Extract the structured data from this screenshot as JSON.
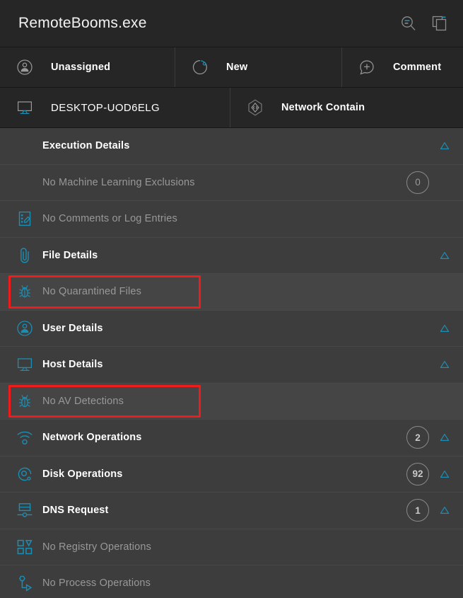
{
  "header": {
    "title": "RemoteBooms.exe",
    "actions": [
      {
        "name": "search-filter-icon",
        "label": "Search"
      },
      {
        "name": "copy-icon",
        "label": "Copy"
      }
    ]
  },
  "meta_rows": [
    [
      {
        "icon": "user-circle-icon",
        "label": "Unassigned",
        "bold": true
      },
      {
        "icon": "status-new-icon",
        "label": "New",
        "bold": true
      },
      {
        "icon": "comment-plus-icon",
        "label": "Comment",
        "bold": true
      }
    ],
    [
      {
        "icon": "monitor-icon",
        "label": "DESKTOP-UOD6ELG",
        "bold": false
      },
      {
        "icon": "network-contain-icon",
        "label": "Network Contain",
        "bold": true
      }
    ]
  ],
  "list": [
    {
      "icon": null,
      "label": "Execution Details",
      "state": "header",
      "count": null,
      "chevron": true,
      "highlight": false
    },
    {
      "icon": null,
      "label": "No Machine Learning Exclusions",
      "state": "muted",
      "count": "0",
      "chevron": false,
      "highlight": false
    },
    {
      "icon": "comments-log-icon",
      "label": "No Comments or Log Entries",
      "state": "muted",
      "count": null,
      "chevron": false,
      "highlight": false
    },
    {
      "icon": "paperclip-icon",
      "label": "File Details",
      "state": "active",
      "count": null,
      "chevron": true,
      "highlight": false
    },
    {
      "icon": "bug-icon",
      "label": "No Quarantined Files",
      "state": "muted",
      "count": null,
      "chevron": false,
      "highlight": true
    },
    {
      "icon": "user-circle-icon",
      "label": "User Details",
      "state": "active",
      "count": null,
      "chevron": true,
      "highlight": false
    },
    {
      "icon": "monitor-icon",
      "label": "Host Details",
      "state": "active",
      "count": null,
      "chevron": true,
      "highlight": false
    },
    {
      "icon": "bug-icon",
      "label": "No AV Detections",
      "state": "muted",
      "count": null,
      "chevron": false,
      "highlight": true
    },
    {
      "icon": "wifi-icon",
      "label": "Network Operations",
      "state": "active",
      "count": "2",
      "chevron": true,
      "highlight": false
    },
    {
      "icon": "disk-icon",
      "label": "Disk Operations",
      "state": "active",
      "count": "92",
      "chevron": true,
      "highlight": false
    },
    {
      "icon": "dns-icon",
      "label": "DNS Request",
      "state": "active",
      "count": "1",
      "chevron": true,
      "highlight": false
    },
    {
      "icon": "registry-icon",
      "label": "No Registry Operations",
      "state": "muted",
      "count": null,
      "chevron": false,
      "highlight": false
    },
    {
      "icon": "process-icon",
      "label": "No Process Operations",
      "state": "muted",
      "count": null,
      "chevron": false,
      "highlight": false
    }
  ],
  "colors": {
    "accent": "#1a8fb5",
    "titlebar_bg": "#262626",
    "list_bg": "#3d3d3d",
    "highlight": "#f01b1b",
    "text_active": "#ffffff",
    "text_muted": "#989898"
  }
}
